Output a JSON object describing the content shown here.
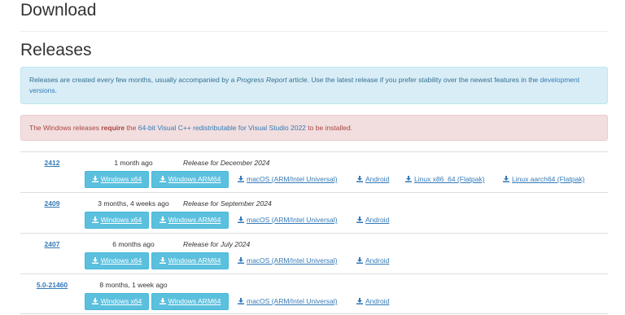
{
  "page": {
    "title": "Download",
    "section_title": "Releases"
  },
  "info_alert": {
    "text_before": "Releases are created every few months, usually accompanied by a ",
    "em_text": "Progress Report",
    "text_middle": " article. Use the latest release if you prefer stability over the newest features in the ",
    "link_text": "development versions",
    "text_after": "."
  },
  "danger_alert": {
    "text_before": "The Windows releases ",
    "strong_text": "require",
    "text_middle": " the ",
    "link_text": "64-bit Visual C++ redistributable for Visual Studio 2022",
    "text_after": " to be installed."
  },
  "icons": {
    "download": "download-icon"
  },
  "colors": {
    "link": "#337ab7",
    "button_bg": "#5bc0de",
    "info_bg": "#d9edf7",
    "danger_bg": "#f2dede",
    "danger_text": "#a94442"
  },
  "releases": [
    {
      "version": "2412",
      "age": "1 month ago",
      "note": "Release for December 2024",
      "win_x64": "Windows x64",
      "win_arm64": "Windows ARM64",
      "macos": "macOS (ARM/Intel Universal)",
      "android": "Android",
      "linux_x86": "Linux x86_64 (Flatpak)",
      "linux_aarch64": "Linux aarch64 (Flatpak)"
    },
    {
      "version": "2409",
      "age": "3 months, 4 weeks ago",
      "note": "Release for September 2024",
      "win_x64": "Windows x64",
      "win_arm64": "Windows ARM64",
      "macos": "macOS (ARM/Intel Universal)",
      "android": "Android"
    },
    {
      "version": "2407",
      "age": "6 months ago",
      "note": "Release for July 2024",
      "win_x64": "Windows x64",
      "win_arm64": "Windows ARM64",
      "macos": "macOS (ARM/Intel Universal)",
      "android": "Android"
    },
    {
      "version": "5.0-21460",
      "age": "8 months, 1 week ago",
      "win_x64": "Windows x64",
      "win_arm64": "Windows ARM64",
      "macos": "macOS (ARM/Intel Universal)",
      "android": "Android"
    }
  ]
}
